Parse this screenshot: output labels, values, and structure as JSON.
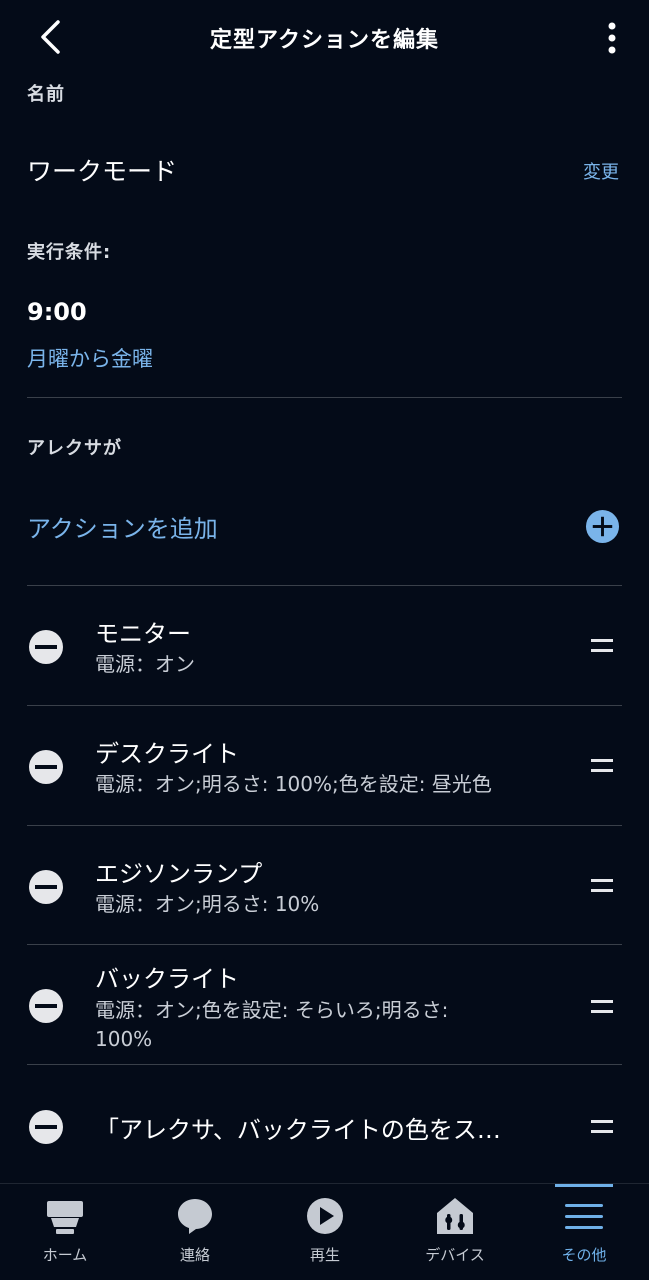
{
  "header": {
    "title": "定型アクションを編集",
    "back_icon": "chevron-left-icon",
    "more_icon": "more-vertical-icon"
  },
  "name_section": {
    "label": "名前",
    "value": "ワークモード",
    "change_label": "変更"
  },
  "trigger_section": {
    "label": "実行条件:",
    "time": "9:00",
    "days": "月曜から金曜"
  },
  "alexa_section": {
    "label": "アレクサが",
    "add_action_label": "アクションを追加"
  },
  "actions": [
    {
      "title": "モニター",
      "detail": "電源：オン"
    },
    {
      "title": "デスクライト",
      "detail": "電源：オン;明るさ: 100%;色を設定: 昼光色"
    },
    {
      "title": "エジソンランプ",
      "detail": "電源：オン;明るさ: 10%"
    },
    {
      "title": "バックライト",
      "detail": "電源：オン;色を設定: そらいろ;明るさ: 100%"
    },
    {
      "title": "「アレクサ、バックライトの色をス…",
      "detail": ""
    }
  ],
  "bottom_nav": {
    "items": [
      {
        "label": "ホーム",
        "icon": "home-icon"
      },
      {
        "label": "連絡",
        "icon": "chat-bubble-icon"
      },
      {
        "label": "再生",
        "icon": "play-icon"
      },
      {
        "label": "デバイス",
        "icon": "devices-house-icon"
      },
      {
        "label": "その他",
        "icon": "menu-icon"
      }
    ],
    "active_index": 4
  },
  "colors": {
    "background": "#040b18",
    "accent": "#7ab4ea",
    "divider": "#3a404a"
  }
}
